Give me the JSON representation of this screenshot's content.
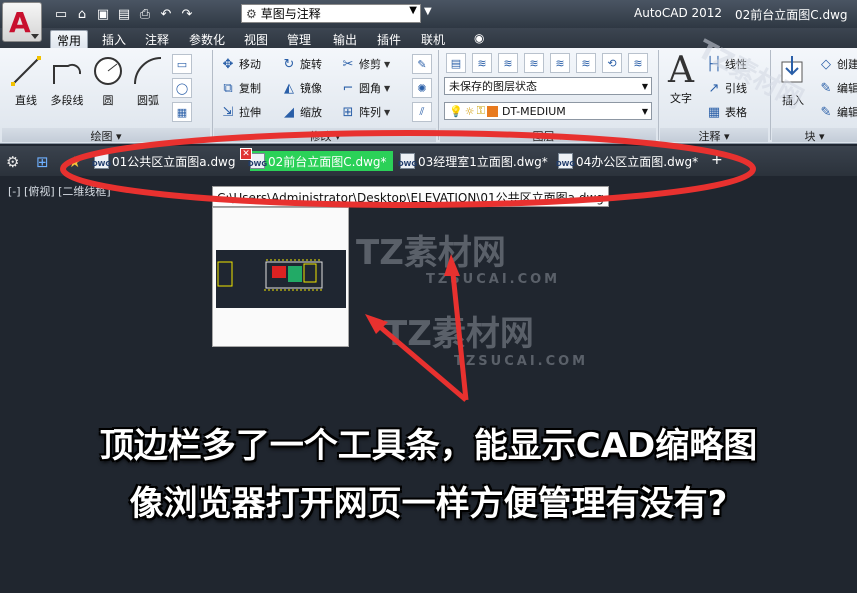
{
  "titlebar": {
    "workspace": "草图与注释",
    "app_name": "AutoCAD 2012",
    "document": "02前台立面图C.dwg"
  },
  "ribbon": {
    "tabs": [
      "常用",
      "插入",
      "注释",
      "参数化",
      "视图",
      "管理",
      "输出",
      "插件",
      "联机"
    ],
    "draw": {
      "label": "绘图",
      "line": "直线",
      "polyline": "多段线",
      "circle": "圆",
      "arc": "圆弧"
    },
    "modify": {
      "label": "修改",
      "move": "移动",
      "rotate": "旋转",
      "trim": "修剪",
      "copy": "复制",
      "mirror": "镜像",
      "fillet": "圆角",
      "stretch": "拉伸",
      "scale": "缩放",
      "array": "阵列"
    },
    "layers": {
      "label": "图层",
      "layer_state": "未保存的图层状态",
      "current_layer": "DT-MEDIUM"
    },
    "annotation": {
      "label": "注释",
      "text": "文字",
      "linear": "线性",
      "leader": "引线",
      "table": "表格"
    },
    "block": {
      "label": "块",
      "insert": "插入",
      "create": "创建",
      "edit": "编辑",
      "edit2": "编辑"
    }
  },
  "filetabs": {
    "items": [
      {
        "name": "01公共区立面图a.dwg",
        "active": false
      },
      {
        "name": "02前台立面图C.dwg*",
        "active": true
      },
      {
        "name": "03经理室1立面图.dwg*",
        "active": false
      },
      {
        "name": "04办公区立面图.dwg*",
        "active": false
      }
    ],
    "add": "+"
  },
  "canvas": {
    "viewport_label": "[-] [俯视] [二维线框]",
    "tooltip_path": "C:\\Users\\Administrator\\Desktop\\ELEVATION\\01公共区立面图a.dwg"
  },
  "watermark": {
    "brand": "TZ素材网",
    "domain": "TZSUCAI.COM"
  },
  "caption": {
    "line1": "顶边栏多了一个工具条，能显示CAD缩略图",
    "line2": "像浏览器打开网页一样方便管理有没有?"
  },
  "colors": {
    "highlight_ellipse": "#e8312f",
    "active_tab": "#2bd158",
    "canvas_bg": "#20262f"
  }
}
